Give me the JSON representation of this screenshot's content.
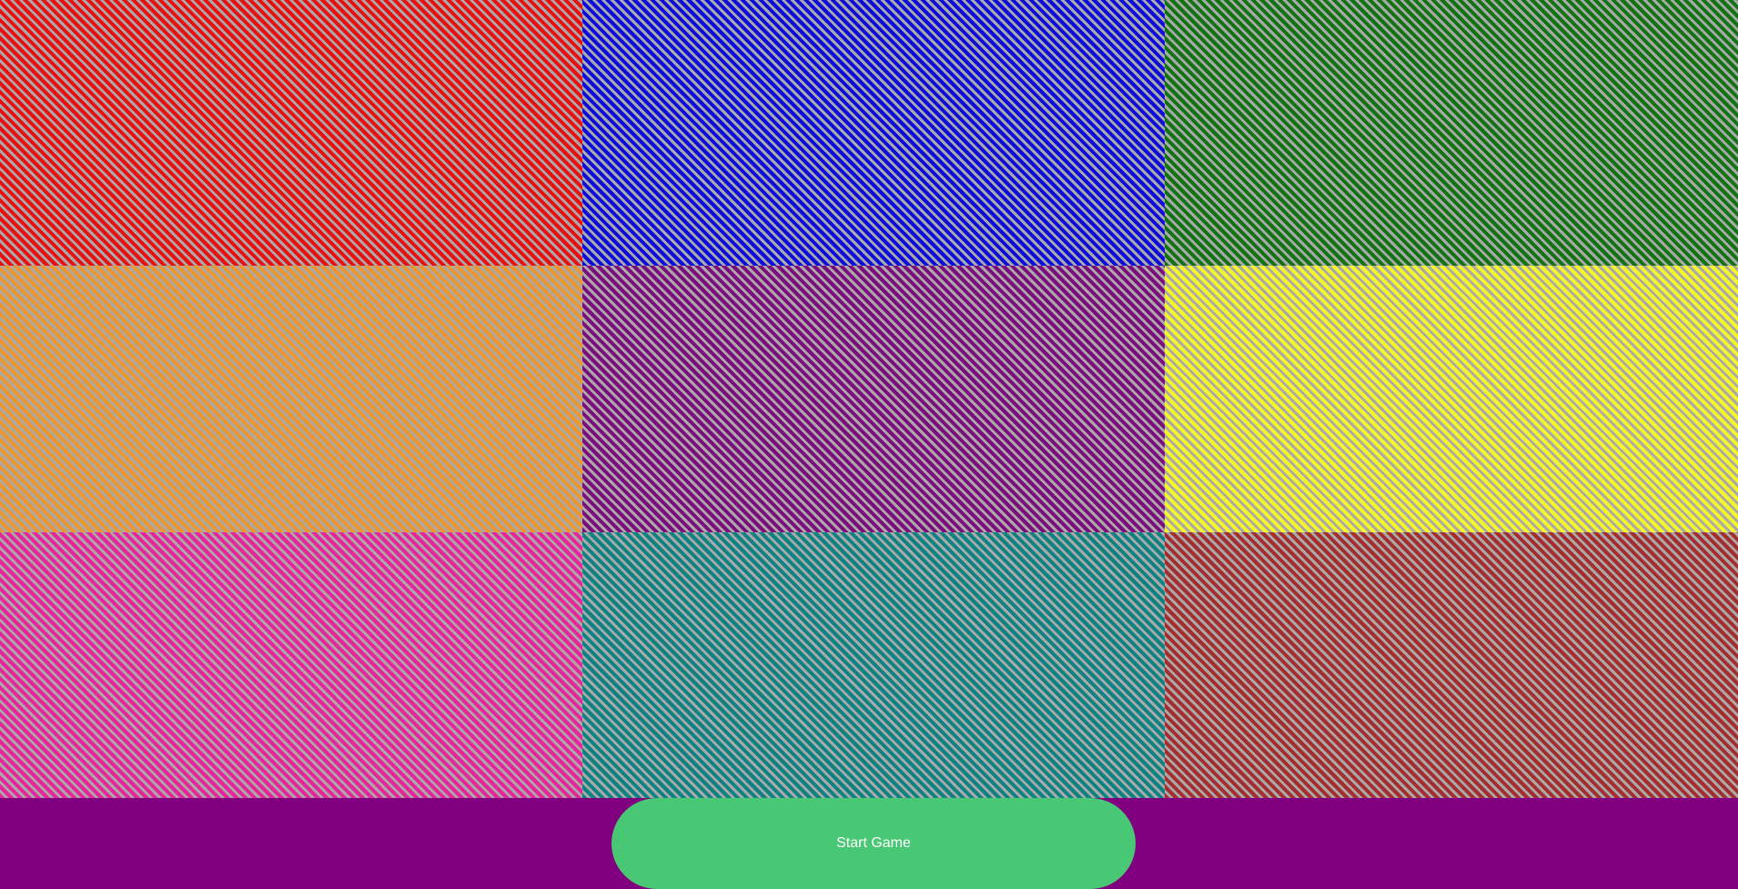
{
  "board": {
    "tiles": [
      {
        "name": "red",
        "color": "#e81010"
      },
      {
        "name": "blue",
        "color": "#0d0ddc"
      },
      {
        "name": "green",
        "color": "#127312"
      },
      {
        "name": "orange",
        "color": "#ee962c"
      },
      {
        "name": "purple",
        "color": "#7d0d7d"
      },
      {
        "name": "yellow",
        "color": "#f5f52a"
      },
      {
        "name": "pink",
        "color": "#e8249a"
      },
      {
        "name": "teal",
        "color": "#0d8282"
      },
      {
        "name": "brown",
        "color": "#a62d2d"
      }
    ],
    "stripe_color": "#a9a9a9",
    "background_color": "#800080"
  },
  "controls": {
    "start_label": "Start Game",
    "start_color": "#48c774"
  }
}
